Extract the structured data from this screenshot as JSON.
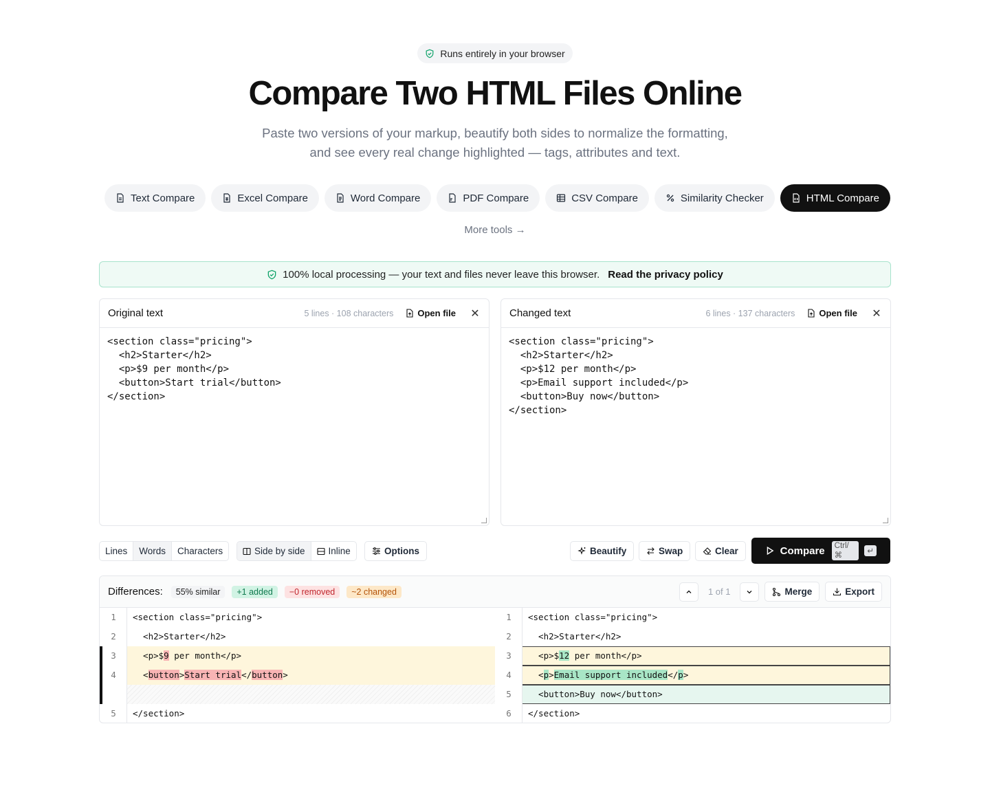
{
  "badge": "Runs entirely in your browser",
  "title": "Compare Two HTML Files Online",
  "subtitle": "Paste two versions of your markup, beautify both sides to normalize the formatting, and see every real change highlighted — tags, attributes and text.",
  "tabs": [
    "Text Compare",
    "Excel Compare",
    "Word Compare",
    "PDF Compare",
    "CSV Compare",
    "Similarity Checker",
    "HTML Compare"
  ],
  "more_tools": "More tools →",
  "privacy": {
    "text": "100% local processing — your text and files never leave this browser.",
    "link": "Read the privacy policy"
  },
  "left_panel": {
    "title": "Original text",
    "meta": "5 lines · 108 characters",
    "open": "Open file",
    "content": "<section class=\"pricing\">\n  <h2>Starter</h2>\n  <p>$9 per month</p>\n  <button>Start trial</button>\n</section>"
  },
  "right_panel": {
    "title": "Changed text",
    "meta": "6 lines · 137 characters",
    "open": "Open file",
    "content": "<section class=\"pricing\">\n  <h2>Starter</h2>\n  <p>$12 per month</p>\n  <p>Email support included</p>\n  <button>Buy now</button>\n</section>"
  },
  "toolbar": {
    "granularity": [
      "Lines",
      "Words",
      "Characters"
    ],
    "view": [
      "Side by side",
      "Inline"
    ],
    "options": "Options",
    "beautify": "Beautify",
    "swap": "Swap",
    "clear": "Clear",
    "compare": "Compare",
    "kbd1": "Ctrl/⌘",
    "kbd2": "↵"
  },
  "diff": {
    "label": "Differences:",
    "similar": "55% similar",
    "added": "+1 added",
    "removed": "−0 removed",
    "changed": "~2 changed",
    "position": "1 of 1",
    "merge": "Merge",
    "export": "Export",
    "line_numbers": {
      "left": [
        "1",
        "2",
        "3",
        "4",
        "",
        "5"
      ],
      "right": [
        "1",
        "2",
        "3",
        "4",
        "5",
        "6"
      ]
    }
  }
}
